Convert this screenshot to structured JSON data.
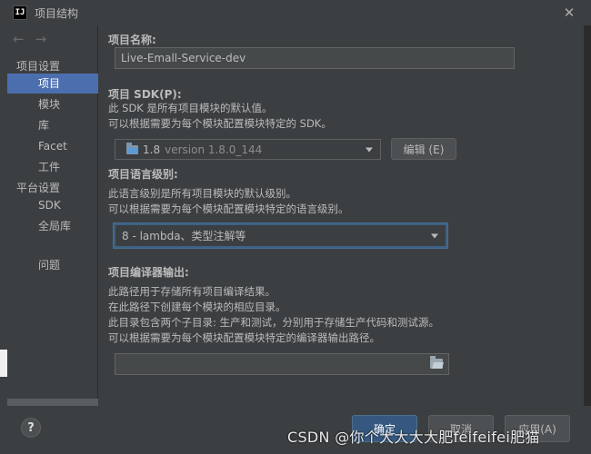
{
  "window": {
    "app_icon_text": "IJ",
    "title": "项目结构",
    "close_glyph": "✕"
  },
  "sidebar": {
    "back_glyph": "←",
    "forward_glyph": "→",
    "section_project": "项目设置",
    "items_project": [
      "项目",
      "模块",
      "库",
      "Facet",
      "工件"
    ],
    "section_platform": "平台设置",
    "items_platform": [
      "SDK",
      "全局库"
    ],
    "problems": "问题",
    "selected": "项目"
  },
  "content": {
    "name_label": "项目名称:",
    "name_value": "Live-Emall-Service-dev",
    "sdk_label": "项目 SDK(P):",
    "sdk_desc_1": "此 SDK 是所有项目模块的默认值。",
    "sdk_desc_2": "可以根据需要为每个模块配置模块特定的 SDK。",
    "sdk_name": "1.8",
    "sdk_version": "version 1.8.0_144",
    "edit_button": "编辑 (E)",
    "lang_label": "项目语言级别:",
    "lang_desc_1": "此语言级别是所有项目模块的默认级别。",
    "lang_desc_2": "可以根据需要为每个模块配置模块特定的语言级别。",
    "lang_value": "8 - lambda、类型注解等",
    "output_label": "项目编译器输出:",
    "output_desc_1": "此路径用于存储所有项目编译结果。",
    "output_desc_2": "在此路径下创建每个模块的相应目录。",
    "output_desc_3": "此目录包含两个子目录: 生产和测试，分别用于存储生产代码和测试源。",
    "output_desc_4": "可以根据需要为每个模块配置模块特定的编译器输出路径。",
    "output_value": ""
  },
  "footer": {
    "help": "?",
    "ok": "确定",
    "cancel": "取消",
    "apply": "应用(A)"
  },
  "watermark": "CSDN @你个大大大大肥feifeifei肥猫"
}
